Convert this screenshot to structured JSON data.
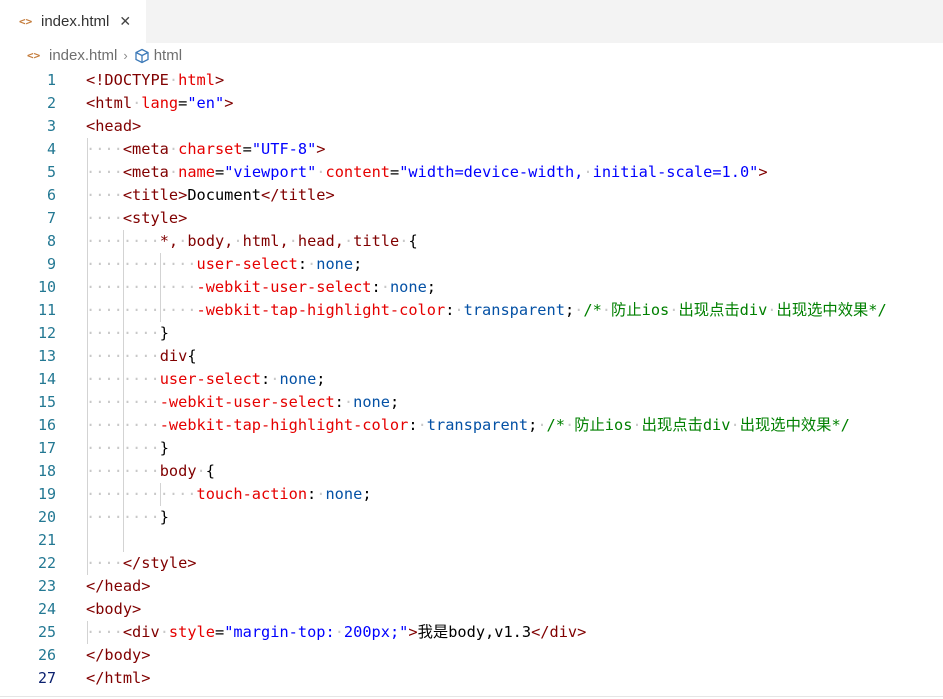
{
  "tab": {
    "label": "index.html",
    "icon": "code-file-icon",
    "close": "✕"
  },
  "breadcrumb": {
    "file": "index.html",
    "separator": "›",
    "symbol": "html",
    "symbol_icon": "cube-icon"
  },
  "colors": {
    "tag": "#800000",
    "attribute": "#e50000",
    "string": "#0000ff",
    "property": "#e50000",
    "value": "#0451a5",
    "comment": "#008000",
    "line_number": "#237893"
  },
  "lines": [
    {
      "n": "1",
      "tokens": [
        [
          "tg",
          "<!DOCTYPE"
        ],
        [
          "ws",
          "·"
        ],
        [
          "at",
          "html"
        ],
        [
          "tg",
          ">"
        ]
      ]
    },
    {
      "n": "2",
      "tokens": [
        [
          "tg",
          "<html"
        ],
        [
          "ws",
          "·"
        ],
        [
          "at",
          "lang"
        ],
        [
          "",
          "="
        ],
        [
          "st",
          "\"en\""
        ],
        [
          "tg",
          ">"
        ]
      ]
    },
    {
      "n": "3",
      "tokens": [
        [
          "tg",
          "<head>"
        ]
      ]
    },
    {
      "n": "4",
      "tokens": [
        [
          "ws",
          "····"
        ],
        [
          "tg",
          "<meta"
        ],
        [
          "ws",
          "·"
        ],
        [
          "at",
          "charset"
        ],
        [
          "",
          "="
        ],
        [
          "st",
          "\"UTF-8\""
        ],
        [
          "tg",
          ">"
        ]
      ]
    },
    {
      "n": "5",
      "tokens": [
        [
          "ws",
          "····"
        ],
        [
          "tg",
          "<meta"
        ],
        [
          "ws",
          "·"
        ],
        [
          "at",
          "name"
        ],
        [
          "",
          "="
        ],
        [
          "st",
          "\"viewport\""
        ],
        [
          "ws",
          "·"
        ],
        [
          "at",
          "content"
        ],
        [
          "",
          "="
        ],
        [
          "st",
          "\"width=device-width,"
        ],
        [
          "ws",
          "·"
        ],
        [
          "st",
          "initial-scale=1.0\""
        ],
        [
          "tg",
          ">"
        ]
      ]
    },
    {
      "n": "6",
      "tokens": [
        [
          "ws",
          "····"
        ],
        [
          "tg",
          "<title>"
        ],
        [
          "",
          "Document"
        ],
        [
          "tg",
          "</title>"
        ]
      ]
    },
    {
      "n": "7",
      "tokens": [
        [
          "ws",
          "····"
        ],
        [
          "tg",
          "<style>"
        ]
      ]
    },
    {
      "n": "8",
      "tokens": [
        [
          "ws",
          "········"
        ],
        [
          "tg",
          "*,"
        ],
        [
          "ws",
          "·"
        ],
        [
          "tg",
          "body,"
        ],
        [
          "ws",
          "·"
        ],
        [
          "tg",
          "html,"
        ],
        [
          "ws",
          "·"
        ],
        [
          "tg",
          "head,"
        ],
        [
          "ws",
          "·"
        ],
        [
          "tg",
          "title"
        ],
        [
          "ws",
          "·"
        ],
        [
          "",
          "{"
        ]
      ]
    },
    {
      "n": "9",
      "tokens": [
        [
          "ws",
          "············"
        ],
        [
          "pr",
          "user-select"
        ],
        [
          "",
          ":"
        ],
        [
          "ws",
          "·"
        ],
        [
          "vl",
          "none"
        ],
        [
          "",
          ";"
        ]
      ]
    },
    {
      "n": "10",
      "tokens": [
        [
          "ws",
          "············"
        ],
        [
          "pr",
          "-webkit-user-select"
        ],
        [
          "",
          ":"
        ],
        [
          "ws",
          "·"
        ],
        [
          "vl",
          "none"
        ],
        [
          "",
          ";"
        ]
      ]
    },
    {
      "n": "11",
      "tokens": [
        [
          "ws",
          "············"
        ],
        [
          "pr",
          "-webkit-tap-highlight-color"
        ],
        [
          "",
          ":"
        ],
        [
          "ws",
          "·"
        ],
        [
          "vl",
          "transparent"
        ],
        [
          "",
          ";"
        ],
        [
          "ws",
          "·"
        ],
        [
          "cm",
          "/*"
        ],
        [
          "ws",
          "·"
        ],
        [
          "cm",
          "防止ios"
        ],
        [
          "ws",
          "·"
        ],
        [
          "cm",
          "出现点击div"
        ],
        [
          "ws",
          "·"
        ],
        [
          "cm",
          "出现选中效果*/"
        ]
      ]
    },
    {
      "n": "12",
      "tokens": [
        [
          "ws",
          "········"
        ],
        [
          "",
          "}"
        ]
      ]
    },
    {
      "n": "13",
      "tokens": [
        [
          "ws",
          "········"
        ],
        [
          "tg",
          "div"
        ],
        [
          "",
          "{"
        ]
      ]
    },
    {
      "n": "14",
      "tokens": [
        [
          "ws",
          "········"
        ],
        [
          "pr",
          "user-select"
        ],
        [
          "",
          ":"
        ],
        [
          "ws",
          "·"
        ],
        [
          "vl",
          "none"
        ],
        [
          "",
          ";"
        ]
      ]
    },
    {
      "n": "15",
      "tokens": [
        [
          "ws",
          "········"
        ],
        [
          "pr",
          "-webkit-user-select"
        ],
        [
          "",
          ":"
        ],
        [
          "ws",
          "·"
        ],
        [
          "vl",
          "none"
        ],
        [
          "",
          ";"
        ]
      ]
    },
    {
      "n": "16",
      "tokens": [
        [
          "ws",
          "········"
        ],
        [
          "pr",
          "-webkit-tap-highlight-color"
        ],
        [
          "",
          ":"
        ],
        [
          "ws",
          "·"
        ],
        [
          "vl",
          "transparent"
        ],
        [
          "",
          ";"
        ],
        [
          "ws",
          "·"
        ],
        [
          "cm",
          "/*"
        ],
        [
          "ws",
          "·"
        ],
        [
          "cm",
          "防止ios"
        ],
        [
          "ws",
          "·"
        ],
        [
          "cm",
          "出现点击div"
        ],
        [
          "ws",
          "·"
        ],
        [
          "cm",
          "出现选中效果*/"
        ]
      ]
    },
    {
      "n": "17",
      "tokens": [
        [
          "ws",
          "········"
        ],
        [
          "",
          "}"
        ]
      ]
    },
    {
      "n": "18",
      "tokens": [
        [
          "ws",
          "········"
        ],
        [
          "tg",
          "body"
        ],
        [
          "ws",
          "·"
        ],
        [
          "",
          "{"
        ]
      ]
    },
    {
      "n": "19",
      "tokens": [
        [
          "ws",
          "············"
        ],
        [
          "pr",
          "touch-action"
        ],
        [
          "",
          ":"
        ],
        [
          "ws",
          "·"
        ],
        [
          "vl",
          "none"
        ],
        [
          "",
          ";"
        ]
      ]
    },
    {
      "n": "20",
      "tokens": [
        [
          "ws",
          "········"
        ],
        [
          "",
          "}"
        ]
      ]
    },
    {
      "n": "21",
      "tokens": []
    },
    {
      "n": "22",
      "tokens": [
        [
          "ws",
          "····"
        ],
        [
          "tg",
          "</style>"
        ]
      ]
    },
    {
      "n": "23",
      "tokens": [
        [
          "tg",
          "</head>"
        ]
      ]
    },
    {
      "n": "24",
      "tokens": [
        [
          "tg",
          "<body>"
        ]
      ]
    },
    {
      "n": "25",
      "tokens": [
        [
          "ws",
          "····"
        ],
        [
          "tg",
          "<div"
        ],
        [
          "ws",
          "·"
        ],
        [
          "at",
          "style"
        ],
        [
          "",
          "="
        ],
        [
          "st",
          "\"margin-top:"
        ],
        [
          "ws",
          "·"
        ],
        [
          "st",
          "200px;\""
        ],
        [
          "tg",
          ">"
        ],
        [
          "",
          "我是body,v1.3"
        ],
        [
          "tg",
          "</div>"
        ]
      ]
    },
    {
      "n": "26",
      "tokens": [
        [
          "tg",
          "</body>"
        ]
      ]
    },
    {
      "n": "27",
      "tokens": [
        [
          "tg",
          "</html>"
        ]
      ]
    }
  ]
}
